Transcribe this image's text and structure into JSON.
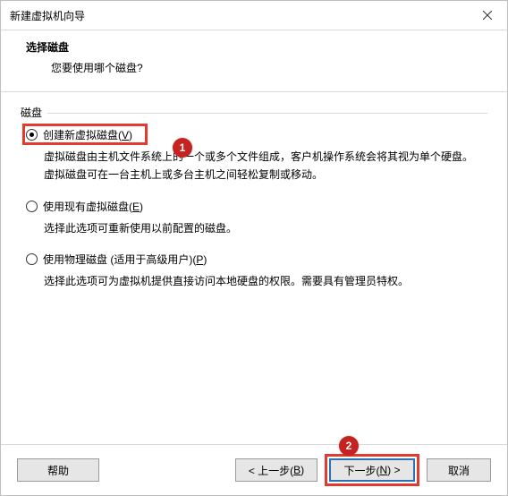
{
  "window": {
    "title": "新建虚拟机向导"
  },
  "header": {
    "title": "选择磁盘",
    "subtitle": "您要使用哪个磁盘?"
  },
  "group": {
    "label": "磁盘"
  },
  "options": [
    {
      "label_pre": "创建新虚拟磁盘(",
      "mnemonic": "V",
      "label_post": ")",
      "desc": "虚拟磁盘由主机文件系统上的一个或多个文件组成，客户机操作系统会将其视为单个硬盘。虚拟磁盘可在一台主机上或多台主机之间轻松复制或移动。",
      "selected": true,
      "highlighted": true
    },
    {
      "label_pre": "使用现有虚拟磁盘(",
      "mnemonic": "E",
      "label_post": ")",
      "desc": "选择此选项可重新使用以前配置的磁盘。",
      "selected": false,
      "highlighted": false
    },
    {
      "label_pre": "使用物理磁盘 (适用于高级用户)(",
      "mnemonic": "P",
      "label_post": ")",
      "desc": "选择此选项可为虚拟机提供直接访问本地硬盘的权限。需要具有管理员特权。",
      "selected": false,
      "highlighted": false
    }
  ],
  "buttons": {
    "help": "帮助",
    "back_pre": "< 上一步(",
    "back_mn": "B",
    "back_post": ")",
    "next_pre": "下一步(",
    "next_mn": "N",
    "next_post": ") >",
    "cancel": "取消"
  },
  "annotations": {
    "badge1": "1",
    "badge2": "2"
  },
  "watermark": ""
}
